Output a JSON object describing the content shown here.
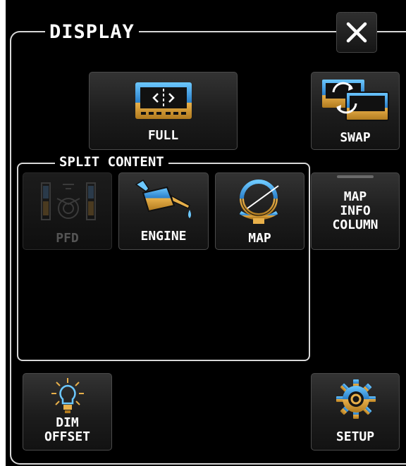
{
  "dialog": {
    "title": "DISPLAY",
    "close": "close-icon"
  },
  "buttons": {
    "full": {
      "label": "FULL",
      "icon": "full-screen-icon"
    },
    "swap": {
      "label": "SWAP",
      "icon": "swap-icon"
    },
    "map_info_column": {
      "label": "MAP\nINFO\nCOLUMN"
    },
    "dim_offset": {
      "label": "DIM\nOFFSET",
      "icon": "lightbulb-icon"
    },
    "setup": {
      "label": "SETUP",
      "icon": "gear-icon"
    }
  },
  "split_content": {
    "title": "SPLIT CONTENT",
    "items": [
      {
        "label": "PFD",
        "icon": "pfd-icon",
        "enabled": false
      },
      {
        "label": "ENGINE",
        "icon": "oil-can-icon",
        "enabled": true
      },
      {
        "label": "MAP",
        "icon": "globe-icon",
        "enabled": true
      }
    ]
  },
  "colors": {
    "background": "#000000",
    "frame": "#d8d8d8",
    "icon_blue": "#4aa8e8",
    "icon_gold": "#e8b04a",
    "disabled": "#555555"
  }
}
